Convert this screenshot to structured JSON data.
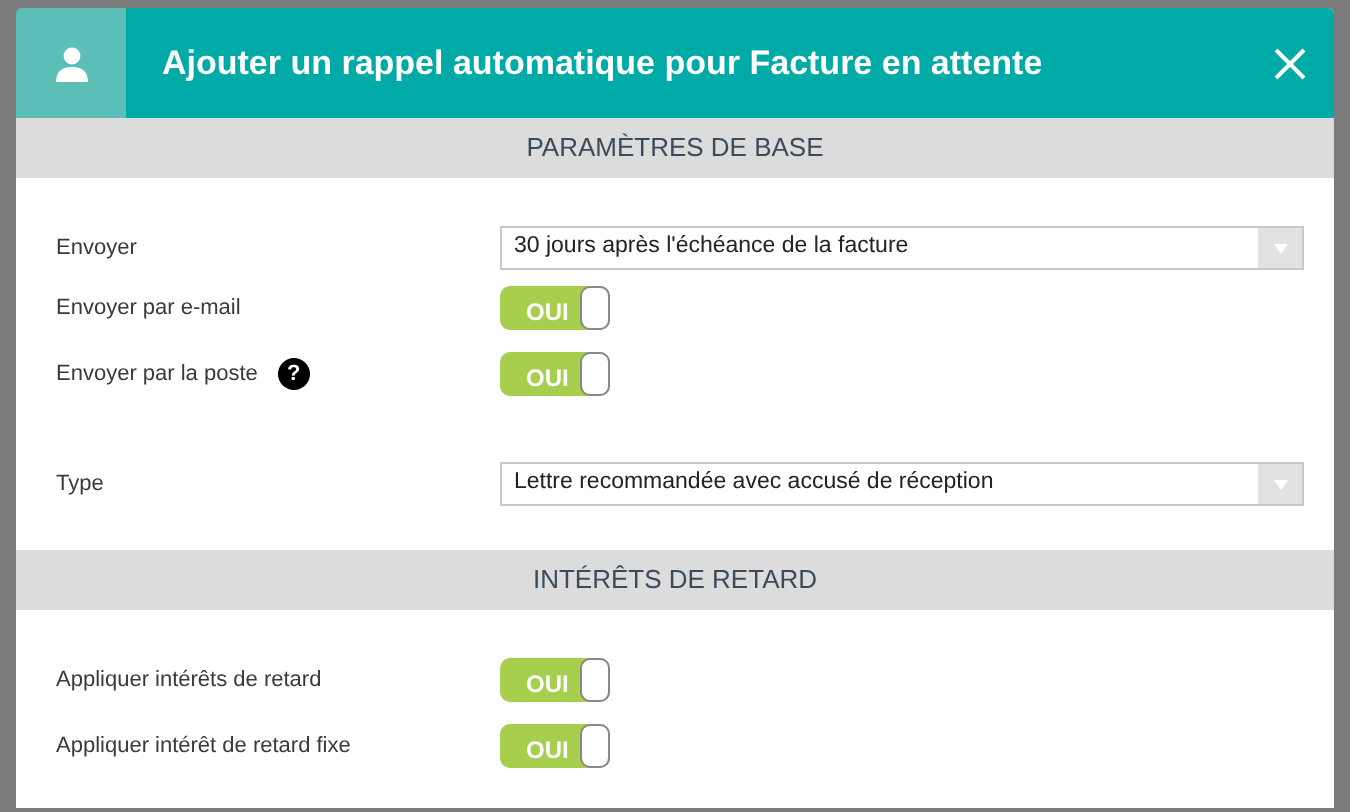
{
  "dialog": {
    "title": "Ajouter un rappel automatique pour Facture en attente",
    "sections": [
      {
        "heading": "PARAMÈTRES DE BASE",
        "rows": [
          {
            "kind": "select",
            "label": "Envoyer",
            "value": "30 jours après l'échéance de la facture"
          },
          {
            "kind": "toggle",
            "label": "Envoyer par e-mail",
            "on": true,
            "toggle_text": "OUI"
          },
          {
            "kind": "toggle",
            "label": "Envoyer par la poste",
            "help": "?",
            "on": true,
            "toggle_text": "OUI"
          },
          {
            "kind": "select",
            "label": "Type",
            "value": "Lettre recommandée avec accusé de réception"
          }
        ]
      },
      {
        "heading": "INTÉRÊTS DE RETARD",
        "rows": [
          {
            "kind": "toggle",
            "label": "Appliquer intérêts de retard",
            "on": true,
            "toggle_text": "OUI"
          },
          {
            "kind": "toggle",
            "label": "Appliquer intérêt de retard fixe",
            "on": true,
            "toggle_text": "OUI"
          }
        ]
      }
    ]
  }
}
